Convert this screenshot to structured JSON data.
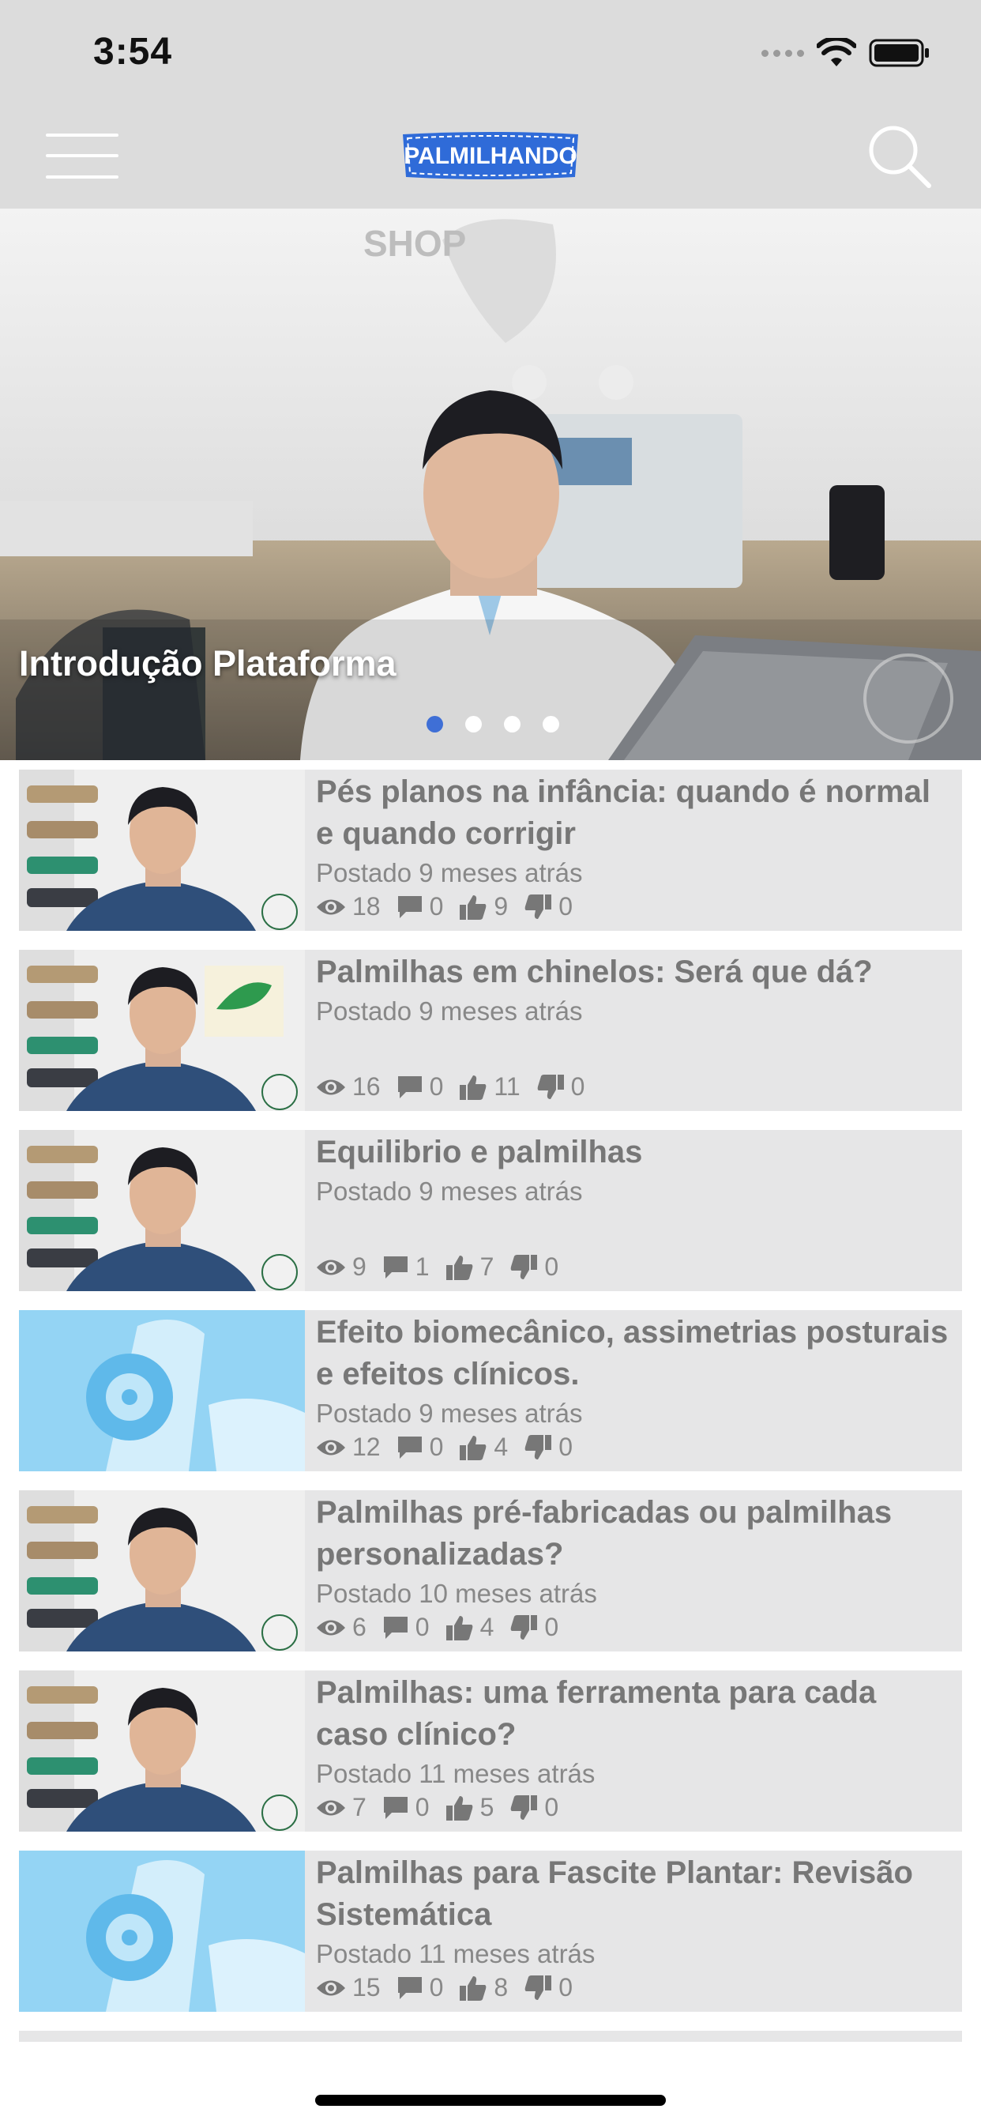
{
  "status_bar": {
    "time": "3:54"
  },
  "header": {
    "logo_text": "PALMILHANDO"
  },
  "hero": {
    "title": "Introdução Plataforma",
    "shop_text": "SHOP",
    "slides": 4,
    "active_slide": 1
  },
  "videos": [
    {
      "title": "Pés planos na infância: quando é normal e quando corrigir",
      "posted": "Postado 9 meses atrás",
      "views": "18",
      "comments": "0",
      "likes": "9",
      "dislikes": "0",
      "thumb": "presenter"
    },
    {
      "title": "Palmilhas em chinelos: Será que dá?",
      "posted": "Postado 9 meses atrás",
      "views": "16",
      "comments": "0",
      "likes": "11",
      "dislikes": "0",
      "thumb": "presenter-sandal"
    },
    {
      "title": "Equilibrio e palmilhas",
      "posted": "Postado 9 meses atrás",
      "views": "9",
      "comments": "1",
      "likes": "7",
      "dislikes": "0",
      "thumb": "presenter"
    },
    {
      "title": "Efeito biomecânico, assimetrias posturais e efeitos clínicos.",
      "posted": "Postado 9 meses atrás",
      "views": "12",
      "comments": "0",
      "likes": "4",
      "dislikes": "0",
      "thumb": "blue-insole"
    },
    {
      "title": "Palmilhas pré-fabricadas ou palmilhas personalizadas?",
      "posted": "Postado 10 meses atrás",
      "views": "6",
      "comments": "0",
      "likes": "4",
      "dislikes": "0",
      "thumb": "presenter"
    },
    {
      "title": "Palmilhas: uma ferramenta para cada caso clínico?",
      "posted": "Postado 11 meses atrás",
      "views": "7",
      "comments": "0",
      "likes": "5",
      "dislikes": "0",
      "thumb": "presenter"
    },
    {
      "title": "Palmilhas para Fascite Plantar:  Revisão Sistemática",
      "posted": "Postado 11 meses atrás",
      "views": "15",
      "comments": "0",
      "likes": "8",
      "dislikes": "0",
      "thumb": "blue-insole"
    }
  ],
  "colors": {
    "header_bg": "#dcdcdc",
    "card_bg": "#e6e6e7",
    "active_dot": "#3f6fd6",
    "logo_blue": "#2f6bd8"
  }
}
